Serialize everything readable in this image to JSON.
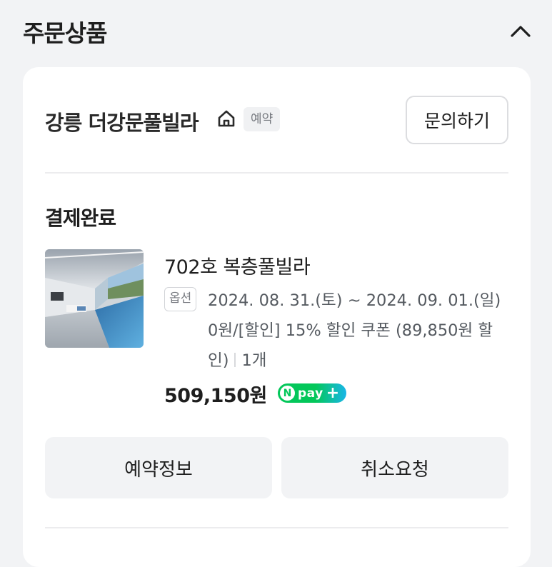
{
  "header": {
    "title": "주문상품"
  },
  "shop": {
    "name": "강릉 더강문풀빌라",
    "badge": "예약",
    "inquiry_label": "문의하기"
  },
  "order": {
    "status": "결제완료",
    "product_name": "702호 복층풀빌라",
    "option_badge": "옵션",
    "option_text": "2024. 08. 31.(토) ~ 2024. 09. 01.(일) 0원/[할인] 15% 할인 쿠폰 (89,850원 할인)",
    "quantity": "1개",
    "price": "509,150원",
    "payment": {
      "logo_text": "pay",
      "logo_letter": "N",
      "plus": "+"
    }
  },
  "actions": {
    "reservation_info": "예약정보",
    "cancel_request": "취소요청"
  },
  "icons": {
    "collapse": "chevron-up-icon",
    "home": "home-icon"
  },
  "colors": {
    "npay_green": "#03c75a",
    "npay_blue": "#19b6e8",
    "background": "#f2f3f5"
  }
}
